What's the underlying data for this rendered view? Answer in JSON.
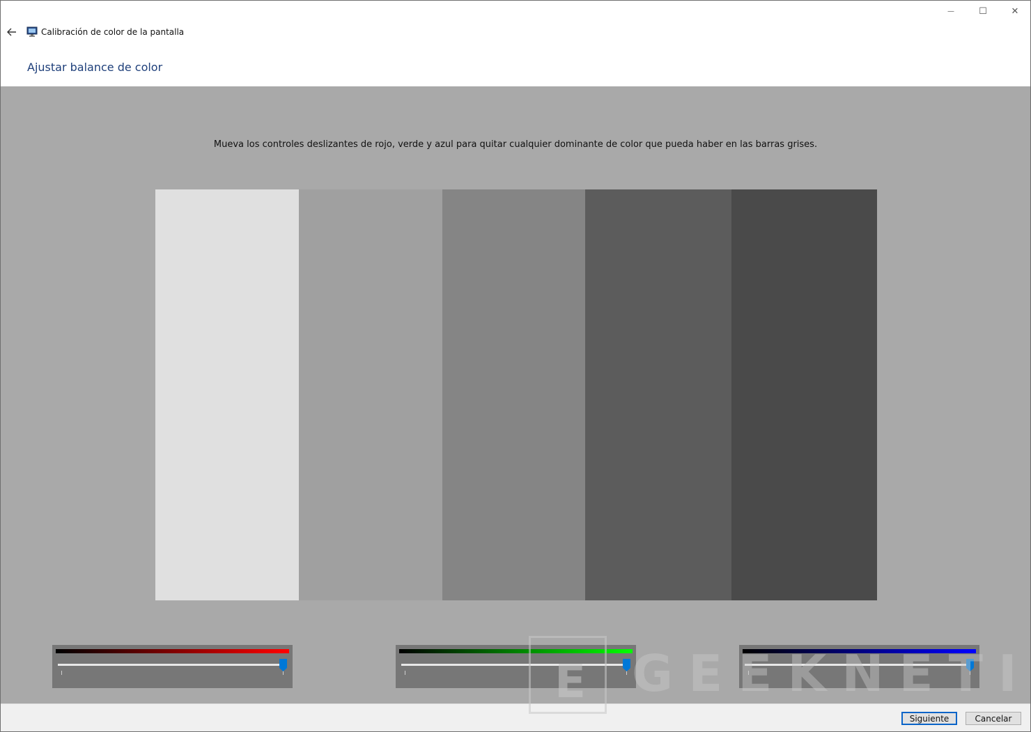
{
  "window": {
    "title": "Calibración de color de la pantalla",
    "caption_buttons": {
      "minimize": "—",
      "maximize": "☐",
      "close": "✕"
    }
  },
  "page": {
    "heading": "Ajustar balance de color",
    "instruction": "Mueva los controles deslizantes de rojo, verde y azul para quitar cualquier dominante de color que pueda haber en las barras grises."
  },
  "gray_bars": [
    {
      "color": "#e0e0e0"
    },
    {
      "color": "#a0a0a0"
    },
    {
      "color": "#858585"
    },
    {
      "color": "#5c5c5c"
    },
    {
      "color": "#4a4a4a"
    }
  ],
  "sliders": [
    {
      "channel": "red",
      "gradient_end": "#ff0000",
      "level": 1.0
    },
    {
      "channel": "green",
      "gradient_end": "#00ff00",
      "level": 1.0
    },
    {
      "channel": "blue",
      "gradient_end": "#0000ff",
      "level": 1.0
    }
  ],
  "footer": {
    "next_label": "Siguiente",
    "cancel_label": "Cancelar"
  },
  "watermark": {
    "logo_letter": "E",
    "text": "GEEKNETIC"
  },
  "colors": {
    "accent": "#0078d7",
    "heading": "#1e3f7a",
    "content_bg": "#a9a9a9"
  }
}
